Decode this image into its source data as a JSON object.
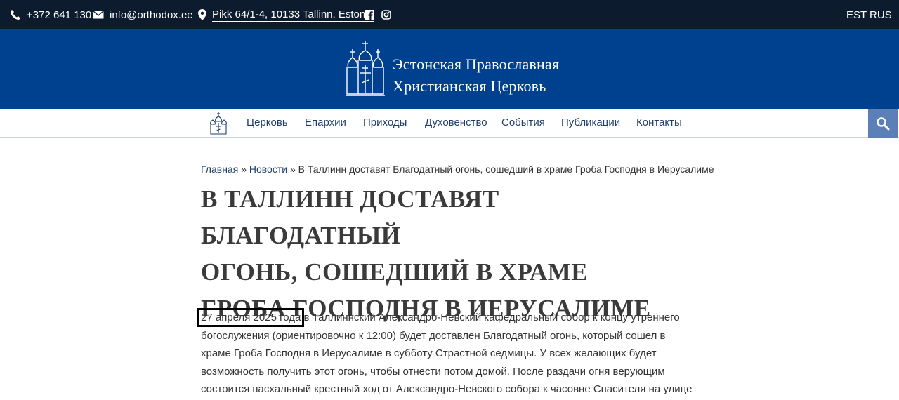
{
  "topbar": {
    "phone": "+372 641 1301",
    "email": "info@orthodox.ee",
    "address": "Pikk 64/1-4, 10133 Tallinn, Estonia",
    "icons": [
      "phone-icon",
      "email-icon",
      "location-icon",
      "facebook-icon",
      "instagram-icon"
    ],
    "languages": [
      "EST",
      "RUS"
    ]
  },
  "header": {
    "name_line1": "Эстонская Православная",
    "name_line2": "Христианская Церковь"
  },
  "nav": {
    "items": [
      "Церковь",
      "Епархии",
      "Приходы",
      "Духовенство",
      "События",
      "Публикации",
      "Контакты"
    ]
  },
  "breadcrumb": {
    "home": "Главная",
    "separator": "»",
    "news": "Новости",
    "current": "В Таллинн доставят Благодатный огонь, сошедший в храме Гроба Господня в Иерусалиме"
  },
  "article": {
    "title_line1": "В ТАЛЛИНН ДОСТАВЯТ БЛАГОДАТНЫЙ",
    "title_line2": "ОГОНЬ, СОШЕДШИЙ В ХРАМЕ",
    "title_line3": "ГРОБА ГОСПОДНЯ В ИЕРУСАЛИМЕ",
    "date": "27 апреля 2025 года",
    "body": " в Таллиннский Александро-Невский кафедральный собор к концу утреннего богослужения (ориентировочно к 12:00) будет доставлен Благодатный огонь, который сошел в храме Гроба Господня в Иерусалиме в субботу Страстной седмицы. У всех желающих будет возможность получить этот огонь, чтобы отнести потом домой. После раздачи огня верующим состоится пасхальный крестный ход от Александро-Невского собора к часовне Спасителя на улице Пикк."
  },
  "colors": {
    "topbar_bg": "#0d1b2e",
    "header_bg": "#00418f",
    "nav_link": "#1f3d6a",
    "search_bg": "#5b7fb7"
  }
}
